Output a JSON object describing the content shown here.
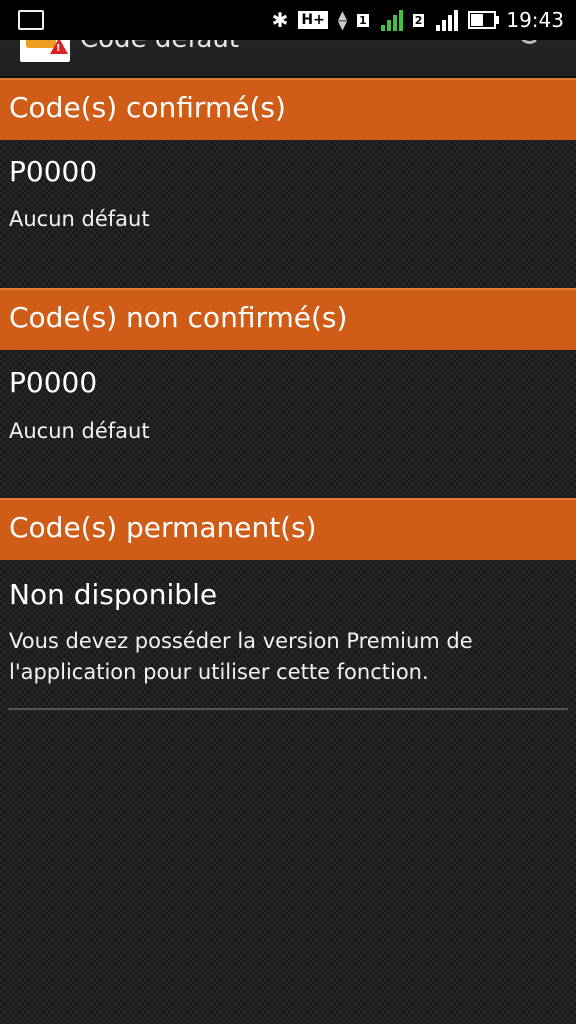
{
  "status_bar": {
    "network_type": "H+",
    "sim1": "1",
    "sim2": "2",
    "time": "19:43",
    "icons": [
      "notification-icon",
      "bluetooth-icon",
      "signal-icon",
      "battery-icon"
    ]
  },
  "app_bar": {
    "title": "Code défaut",
    "icons": [
      "check-engine-icon",
      "refresh-icon"
    ]
  },
  "sections": [
    {
      "header": "Code(s) confirmé(s)",
      "code": "P0000",
      "description": "Aucun défaut"
    },
    {
      "header": "Code(s) non confirmé(s)",
      "code": "P0000",
      "description": "Aucun défaut"
    },
    {
      "header": "Code(s) permanent(s)",
      "code": "Non disponible",
      "description": "Vous devez posséder la version Premium de l'application pour utiliser cette fonction."
    }
  ],
  "colors": {
    "header_bg": "#cf5d18",
    "background": "#262626",
    "text": "#ffffff"
  }
}
